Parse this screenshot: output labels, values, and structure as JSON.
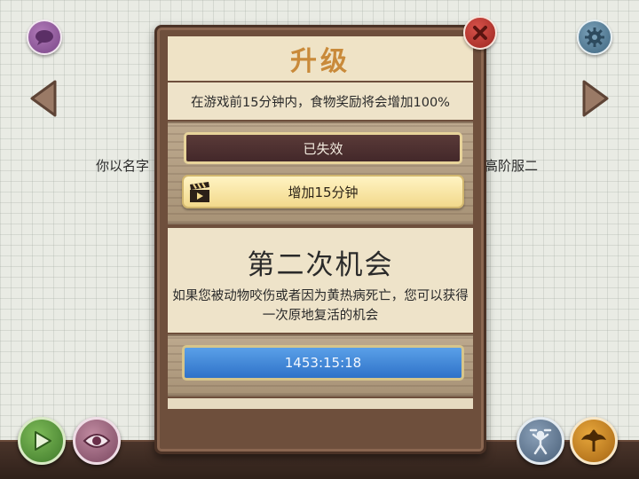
{
  "side_text_left": "你以名字",
  "side_text_right": "高阶服二",
  "dialog": {
    "title": "升级",
    "description": "在游戏前15分钟内，食物奖励将会增加100%",
    "expired_label": "已失效",
    "add_time_label": "增加15分钟",
    "second_chance_title": "第二次机会",
    "second_chance_desc": "如果您被动物咬伤或者因为黄热病死亡，您可以获得一次原地复活的机会",
    "timer": "1453:15:18"
  },
  "icons": [
    "chat-icon",
    "gear-icon",
    "close-icon",
    "left-arrow-icon",
    "right-arrow-icon",
    "clapperboard-icon",
    "play-icon",
    "eye-icon",
    "dance-icon",
    "wings-icon"
  ],
  "colors": {
    "title": "#c98a3a",
    "timer_button": "#2f72c8",
    "expired_button": "#43282a",
    "add_button": "#f2d98c"
  }
}
